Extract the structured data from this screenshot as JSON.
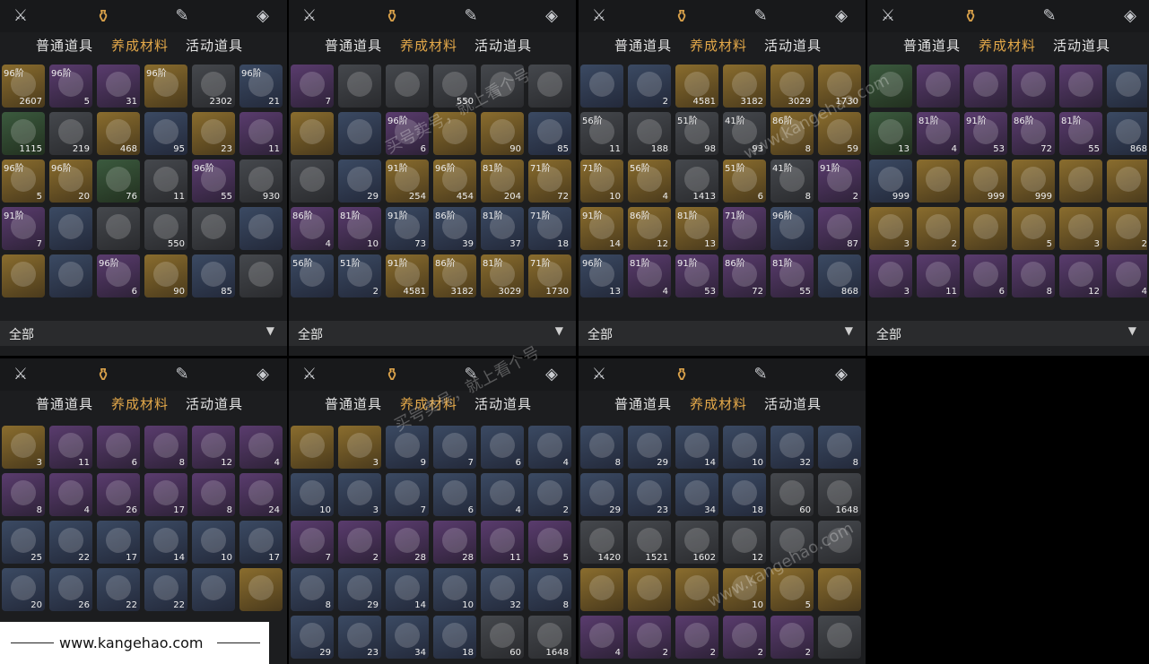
{
  "tabs": {
    "common": "普通道具",
    "cultivate": "养成材料",
    "event": "活动道具"
  },
  "filter": {
    "label": "全部",
    "arrow": "▼"
  },
  "footer": {
    "site": "www.kangehao.com"
  },
  "watermark": {
    "text1": "买号卖号，就上看个号",
    "text2": "www.kangehao.com"
  },
  "panels": [
    {
      "cells": [
        {
          "t": "96阶",
          "c": "2607",
          "k": "gold"
        },
        {
          "t": "96阶",
          "c": "5",
          "k": "purple"
        },
        {
          "t": "",
          "c": "31",
          "k": "purple"
        },
        {
          "t": "96阶",
          "c": "",
          "k": "gold"
        },
        {
          "t": "",
          "c": "2302",
          "k": "gray"
        },
        {
          "t": "96阶",
          "c": "21",
          "k": "blue"
        },
        {
          "t": "",
          "c": "1115",
          "k": "green"
        },
        {
          "t": "",
          "c": "219",
          "k": "gray"
        },
        {
          "t": "",
          "c": "468",
          "k": "gold"
        },
        {
          "t": "",
          "c": "95",
          "k": "blue"
        },
        {
          "t": "",
          "c": "23",
          "k": "gold"
        },
        {
          "t": "",
          "c": "11",
          "k": "purple"
        },
        {
          "t": "96阶",
          "c": "5",
          "k": "gold"
        },
        {
          "t": "96阶",
          "c": "20",
          "k": "gold"
        },
        {
          "t": "",
          "c": "76",
          "k": "green"
        },
        {
          "t": "",
          "c": "11",
          "k": "gray"
        },
        {
          "t": "96阶",
          "c": "55",
          "k": "purple"
        },
        {
          "t": "",
          "c": "930",
          "k": "gray"
        },
        {
          "t": "91阶",
          "c": "7",
          "k": "purple"
        },
        {
          "t": "",
          "c": "",
          "k": "blue"
        },
        {
          "t": "",
          "c": "",
          "k": "gray"
        },
        {
          "t": "",
          "c": "550",
          "k": "gray"
        },
        {
          "t": "",
          "c": "",
          "k": "gray"
        },
        {
          "t": "",
          "c": "",
          "k": "blue"
        },
        {
          "t": "",
          "c": "",
          "k": "gold"
        },
        {
          "t": "",
          "c": "",
          "k": "blue"
        },
        {
          "t": "96阶",
          "c": "6",
          "k": "purple"
        },
        {
          "t": "",
          "c": "90",
          "k": "gold"
        },
        {
          "t": "",
          "c": "85",
          "k": "blue"
        },
        {
          "t": "",
          "c": "",
          "k": "gray"
        }
      ]
    },
    {
      "cells": [
        {
          "t": "",
          "c": "7",
          "k": "purple"
        },
        {
          "t": "",
          "c": "",
          "k": "gray"
        },
        {
          "t": "",
          "c": "",
          "k": "gray"
        },
        {
          "t": "",
          "c": "550",
          "k": "gray"
        },
        {
          "t": "",
          "c": "",
          "k": "gray"
        },
        {
          "t": "",
          "c": "",
          "k": "gray"
        },
        {
          "t": "",
          "c": "",
          "k": "gold"
        },
        {
          "t": "",
          "c": "",
          "k": "blue"
        },
        {
          "t": "96阶",
          "c": "6",
          "k": "purple"
        },
        {
          "t": "",
          "c": "",
          "k": "gold"
        },
        {
          "t": "",
          "c": "90",
          "k": "gold"
        },
        {
          "t": "",
          "c": "85",
          "k": "blue"
        },
        {
          "t": "",
          "c": "",
          "k": "gray"
        },
        {
          "t": "",
          "c": "29",
          "k": "blue"
        },
        {
          "t": "91阶",
          "c": "254",
          "k": "gold"
        },
        {
          "t": "96阶",
          "c": "454",
          "k": "gold"
        },
        {
          "t": "81阶",
          "c": "204",
          "k": "gold"
        },
        {
          "t": "71阶",
          "c": "72",
          "k": "gold"
        },
        {
          "t": "86阶",
          "c": "4",
          "k": "purple"
        },
        {
          "t": "81阶",
          "c": "10",
          "k": "purple"
        },
        {
          "t": "91阶",
          "c": "73",
          "k": "blue"
        },
        {
          "t": "86阶",
          "c": "39",
          "k": "blue"
        },
        {
          "t": "81阶",
          "c": "37",
          "k": "blue"
        },
        {
          "t": "71阶",
          "c": "18",
          "k": "blue"
        },
        {
          "t": "56阶",
          "c": "",
          "k": "blue"
        },
        {
          "t": "51阶",
          "c": "2",
          "k": "blue"
        },
        {
          "t": "91阶",
          "c": "4581",
          "k": "gold"
        },
        {
          "t": "86阶",
          "c": "3182",
          "k": "gold"
        },
        {
          "t": "81阶",
          "c": "3029",
          "k": "gold"
        },
        {
          "t": "71阶",
          "c": "1730",
          "k": "gold"
        }
      ]
    },
    {
      "cells": [
        {
          "t": "",
          "c": "",
          "k": "blue"
        },
        {
          "t": "",
          "c": "2",
          "k": "blue"
        },
        {
          "t": "",
          "c": "4581",
          "k": "gold"
        },
        {
          "t": "",
          "c": "3182",
          "k": "gold"
        },
        {
          "t": "",
          "c": "3029",
          "k": "gold"
        },
        {
          "t": "",
          "c": "1730",
          "k": "gold"
        },
        {
          "t": "56阶",
          "c": "11",
          "k": "gray"
        },
        {
          "t": "",
          "c": "188",
          "k": "gray"
        },
        {
          "t": "51阶",
          "c": "98",
          "k": "gray"
        },
        {
          "t": "41阶",
          "c": "93",
          "k": "gray"
        },
        {
          "t": "86阶",
          "c": "8",
          "k": "gold"
        },
        {
          "t": "",
          "c": "59",
          "k": "gold"
        },
        {
          "t": "71阶",
          "c": "10",
          "k": "gold"
        },
        {
          "t": "56阶",
          "c": "4",
          "k": "gold"
        },
        {
          "t": "",
          "c": "1413",
          "k": "gray"
        },
        {
          "t": "51阶",
          "c": "6",
          "k": "gold"
        },
        {
          "t": "41阶",
          "c": "8",
          "k": "gray"
        },
        {
          "t": "91阶",
          "c": "2",
          "k": "purple"
        },
        {
          "t": "91阶",
          "c": "14",
          "k": "gold"
        },
        {
          "t": "86阶",
          "c": "12",
          "k": "gold"
        },
        {
          "t": "81阶",
          "c": "13",
          "k": "gold"
        },
        {
          "t": "71阶",
          "c": "",
          "k": "purple"
        },
        {
          "t": "96阶",
          "c": "",
          "k": "blue"
        },
        {
          "t": "",
          "c": "87",
          "k": "purple"
        },
        {
          "t": "96阶",
          "c": "13",
          "k": "blue"
        },
        {
          "t": "81阶",
          "c": "4",
          "k": "purple"
        },
        {
          "t": "91阶",
          "c": "53",
          "k": "purple"
        },
        {
          "t": "86阶",
          "c": "72",
          "k": "purple"
        },
        {
          "t": "81阶",
          "c": "55",
          "k": "purple"
        },
        {
          "t": "",
          "c": "868",
          "k": "blue"
        }
      ]
    },
    {
      "cells": [
        {
          "t": "",
          "c": "",
          "k": "green"
        },
        {
          "t": "",
          "c": "",
          "k": "purple"
        },
        {
          "t": "",
          "c": "",
          "k": "purple"
        },
        {
          "t": "",
          "c": "",
          "k": "purple"
        },
        {
          "t": "",
          "c": "",
          "k": "purple"
        },
        {
          "t": "",
          "c": "",
          "k": "blue"
        },
        {
          "t": "",
          "c": "13",
          "k": "green"
        },
        {
          "t": "81阶",
          "c": "4",
          "k": "purple"
        },
        {
          "t": "91阶",
          "c": "53",
          "k": "purple"
        },
        {
          "t": "86阶",
          "c": "72",
          "k": "purple"
        },
        {
          "t": "81阶",
          "c": "55",
          "k": "purple"
        },
        {
          "t": "",
          "c": "868",
          "k": "blue"
        },
        {
          "t": "",
          "c": "999",
          "k": "blue"
        },
        {
          "t": "",
          "c": "",
          "k": "gold"
        },
        {
          "t": "",
          "c": "999",
          "k": "gold"
        },
        {
          "t": "",
          "c": "999",
          "k": "gold"
        },
        {
          "t": "",
          "c": "",
          "k": "gold"
        },
        {
          "t": "",
          "c": "",
          "k": "gold"
        },
        {
          "t": "",
          "c": "3",
          "k": "gold"
        },
        {
          "t": "",
          "c": "2",
          "k": "gold"
        },
        {
          "t": "",
          "c": "",
          "k": "gold"
        },
        {
          "t": "",
          "c": "5",
          "k": "gold"
        },
        {
          "t": "",
          "c": "3",
          "k": "gold"
        },
        {
          "t": "",
          "c": "2",
          "k": "gold"
        },
        {
          "t": "",
          "c": "3",
          "k": "purple"
        },
        {
          "t": "",
          "c": "11",
          "k": "purple"
        },
        {
          "t": "",
          "c": "6",
          "k": "purple"
        },
        {
          "t": "",
          "c": "8",
          "k": "purple"
        },
        {
          "t": "",
          "c": "12",
          "k": "purple"
        },
        {
          "t": "",
          "c": "4",
          "k": "purple"
        }
      ]
    },
    {
      "cells": [
        {
          "t": "",
          "c": "3",
          "k": "gold"
        },
        {
          "t": "",
          "c": "11",
          "k": "purple"
        },
        {
          "t": "",
          "c": "6",
          "k": "purple"
        },
        {
          "t": "",
          "c": "8",
          "k": "purple"
        },
        {
          "t": "",
          "c": "12",
          "k": "purple"
        },
        {
          "t": "",
          "c": "4",
          "k": "purple"
        },
        {
          "t": "",
          "c": "8",
          "k": "purple"
        },
        {
          "t": "",
          "c": "4",
          "k": "purple"
        },
        {
          "t": "",
          "c": "26",
          "k": "purple"
        },
        {
          "t": "",
          "c": "17",
          "k": "purple"
        },
        {
          "t": "",
          "c": "8",
          "k": "purple"
        },
        {
          "t": "",
          "c": "24",
          "k": "purple"
        },
        {
          "t": "",
          "c": "25",
          "k": "blue"
        },
        {
          "t": "",
          "c": "22",
          "k": "blue"
        },
        {
          "t": "",
          "c": "17",
          "k": "blue"
        },
        {
          "t": "",
          "c": "14",
          "k": "blue"
        },
        {
          "t": "",
          "c": "10",
          "k": "blue"
        },
        {
          "t": "",
          "c": "17",
          "k": "blue"
        },
        {
          "t": "",
          "c": "20",
          "k": "blue"
        },
        {
          "t": "",
          "c": "26",
          "k": "blue"
        },
        {
          "t": "",
          "c": "22",
          "k": "blue"
        },
        {
          "t": "",
          "c": "22",
          "k": "blue"
        },
        {
          "t": "",
          "c": "",
          "k": "blue"
        },
        {
          "t": "",
          "c": "",
          "k": "gold"
        }
      ]
    },
    {
      "cells": [
        {
          "t": "",
          "c": "",
          "k": "gold"
        },
        {
          "t": "",
          "c": "3",
          "k": "gold"
        },
        {
          "t": "",
          "c": "9",
          "k": "blue"
        },
        {
          "t": "",
          "c": "7",
          "k": "blue"
        },
        {
          "t": "",
          "c": "6",
          "k": "blue"
        },
        {
          "t": "",
          "c": "4",
          "k": "blue"
        },
        {
          "t": "",
          "c": "10",
          "k": "blue"
        },
        {
          "t": "",
          "c": "3",
          "k": "blue"
        },
        {
          "t": "",
          "c": "7",
          "k": "blue"
        },
        {
          "t": "",
          "c": "6",
          "k": "blue"
        },
        {
          "t": "",
          "c": "4",
          "k": "blue"
        },
        {
          "t": "",
          "c": "2",
          "k": "blue"
        },
        {
          "t": "",
          "c": "7",
          "k": "purple"
        },
        {
          "t": "",
          "c": "2",
          "k": "purple"
        },
        {
          "t": "",
          "c": "28",
          "k": "purple"
        },
        {
          "t": "",
          "c": "28",
          "k": "purple"
        },
        {
          "t": "",
          "c": "11",
          "k": "purple"
        },
        {
          "t": "",
          "c": "5",
          "k": "purple"
        },
        {
          "t": "",
          "c": "8",
          "k": "blue"
        },
        {
          "t": "",
          "c": "29",
          "k": "blue"
        },
        {
          "t": "",
          "c": "14",
          "k": "blue"
        },
        {
          "t": "",
          "c": "10",
          "k": "blue"
        },
        {
          "t": "",
          "c": "32",
          "k": "blue"
        },
        {
          "t": "",
          "c": "8",
          "k": "blue"
        },
        {
          "t": "",
          "c": "29",
          "k": "blue"
        },
        {
          "t": "",
          "c": "23",
          "k": "blue"
        },
        {
          "t": "",
          "c": "34",
          "k": "blue"
        },
        {
          "t": "",
          "c": "18",
          "k": "blue"
        },
        {
          "t": "",
          "c": "60",
          "k": "gray"
        },
        {
          "t": "",
          "c": "1648",
          "k": "gray"
        }
      ]
    },
    {
      "cells": [
        {
          "t": "",
          "c": "8",
          "k": "blue"
        },
        {
          "t": "",
          "c": "29",
          "k": "blue"
        },
        {
          "t": "",
          "c": "14",
          "k": "blue"
        },
        {
          "t": "",
          "c": "10",
          "k": "blue"
        },
        {
          "t": "",
          "c": "32",
          "k": "blue"
        },
        {
          "t": "",
          "c": "8",
          "k": "blue"
        },
        {
          "t": "",
          "c": "29",
          "k": "blue"
        },
        {
          "t": "",
          "c": "23",
          "k": "blue"
        },
        {
          "t": "",
          "c": "34",
          "k": "blue"
        },
        {
          "t": "",
          "c": "18",
          "k": "blue"
        },
        {
          "t": "",
          "c": "60",
          "k": "gray"
        },
        {
          "t": "",
          "c": "1648",
          "k": "gray"
        },
        {
          "t": "",
          "c": "1420",
          "k": "gray"
        },
        {
          "t": "",
          "c": "1521",
          "k": "gray"
        },
        {
          "t": "",
          "c": "1602",
          "k": "gray"
        },
        {
          "t": "",
          "c": "12",
          "k": "gray"
        },
        {
          "t": "",
          "c": "",
          "k": "gray"
        },
        {
          "t": "",
          "c": "",
          "k": "gray"
        },
        {
          "t": "",
          "c": "",
          "k": "gold"
        },
        {
          "t": "",
          "c": "",
          "k": "gold"
        },
        {
          "t": "",
          "c": "",
          "k": "gold"
        },
        {
          "t": "",
          "c": "10",
          "k": "gold"
        },
        {
          "t": "",
          "c": "5",
          "k": "gold"
        },
        {
          "t": "",
          "c": "",
          "k": "gold"
        },
        {
          "t": "",
          "c": "4",
          "k": "purple"
        },
        {
          "t": "",
          "c": "2",
          "k": "purple"
        },
        {
          "t": "",
          "c": "2",
          "k": "purple"
        },
        {
          "t": "",
          "c": "2",
          "k": "purple"
        },
        {
          "t": "",
          "c": "2",
          "k": "purple"
        },
        {
          "t": "",
          "c": "",
          "k": "gray"
        }
      ]
    }
  ]
}
